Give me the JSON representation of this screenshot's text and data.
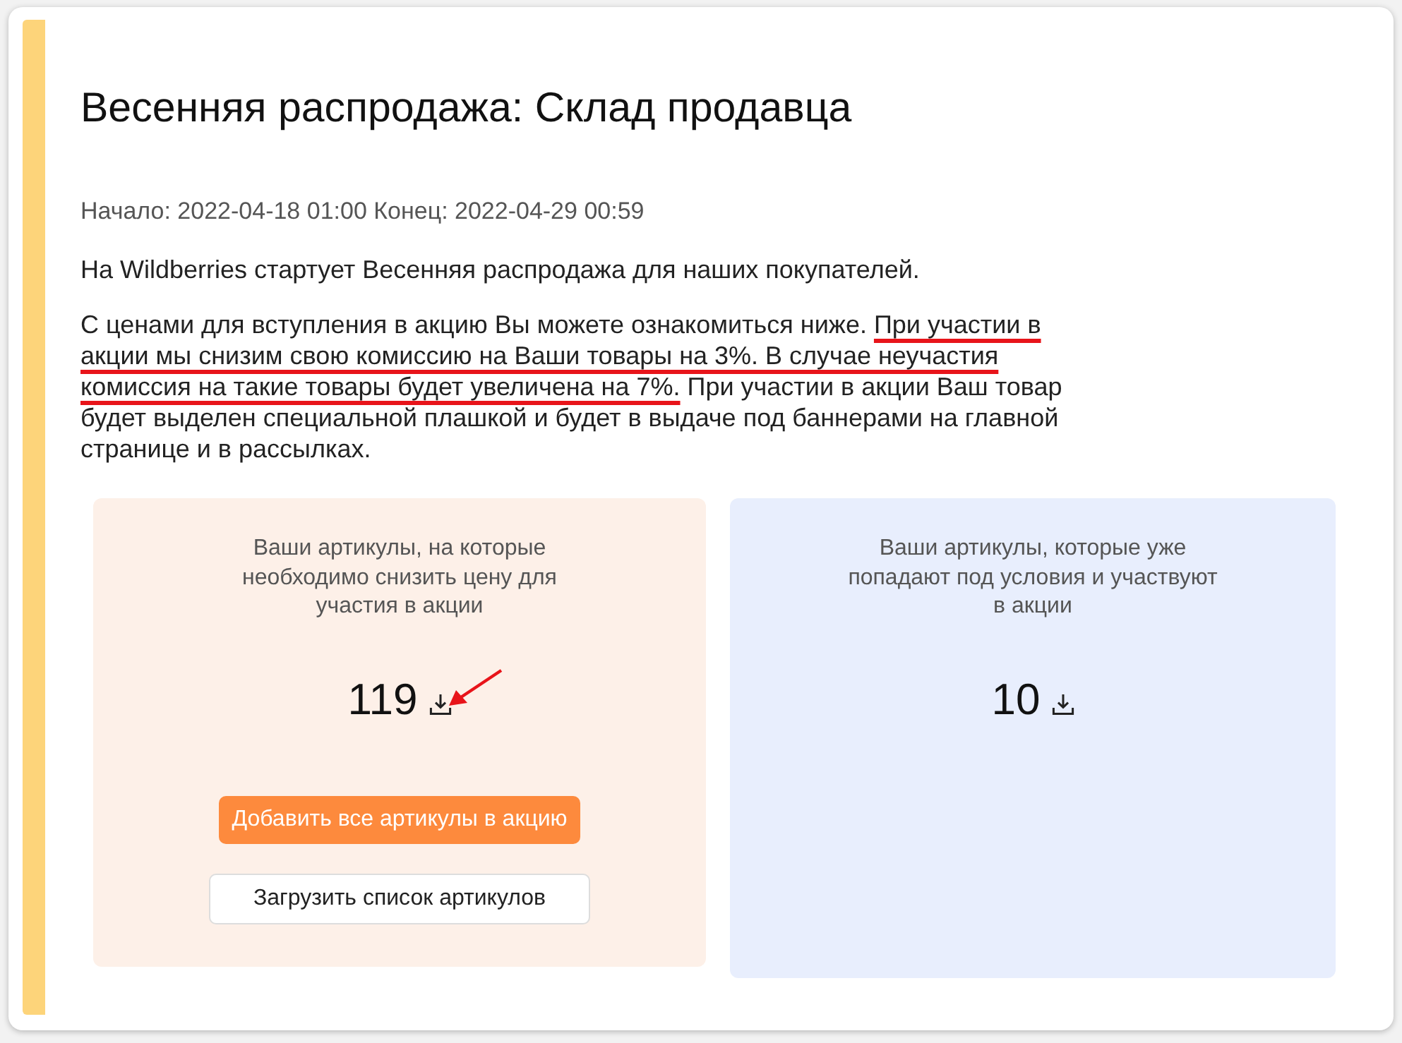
{
  "title": "Весенняя распродажа: Склад продавца",
  "period": "Начало: 2022-04-18 01:00 Конец: 2022-04-29 00:59",
  "intro": "На Wildberries стартует Весенняя распродажа для наших покупателей.",
  "details": [
    {
      "text": "С ценами для вступления в акцию Вы можете ознакомиться ниже. ",
      "underlined": false
    },
    {
      "text": "При участии в акции мы снизим свою комиссию на Ваши товары на 3%. В случае неучастия комиссия на такие товары будет увеличена на 7%.",
      "underlined": true
    },
    {
      "text": " При участии в акции Ваш товар будет выделен специальной плашкой и будет в выдаче под баннерами на главной странице и в рассылках.",
      "underlined": false
    }
  ],
  "cards": [
    {
      "kind": "reduce",
      "description": "Ваши артикулы, на которые необходимо снизить цену для участия в акции",
      "count": "119",
      "annotated": true,
      "buttons": [
        {
          "kind": "primary",
          "label": "Добавить все артикулы в акцию"
        },
        {
          "kind": "secondary",
          "label": "Загрузить список артикулов"
        }
      ]
    },
    {
      "kind": "participating",
      "description": "Ваши артикулы, которые уже попадают под условия и участвуют в акции",
      "count": "10",
      "annotated": false
    }
  ]
}
